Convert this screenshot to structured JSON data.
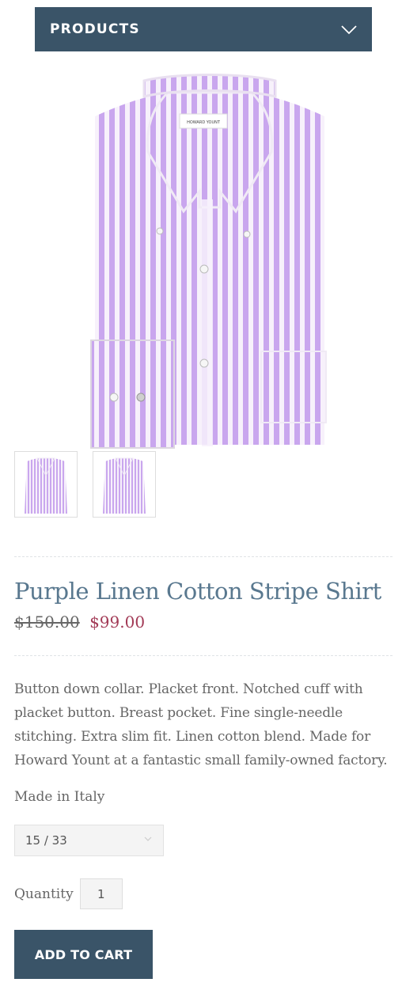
{
  "nav": {
    "title": "PRODUCTS",
    "icon": "chevron-down-icon"
  },
  "product": {
    "title": "Purple Linen Cotton Stripe Shirt",
    "price_original": "$150.00",
    "price_sale": "$99.00",
    "description": "Button down collar. Placket front. Notched cuff with placket button. Breast pocket. Fine single-needle stitching. Extra slim fit. Linen cotton blend. Made for Howard Yount at a fantastic small family-owned factory.",
    "origin": "Made in Italy",
    "label_text": "HOWARD YOUNT"
  },
  "variant_select": {
    "value": "15 / 33"
  },
  "quantity": {
    "label": "Quantity",
    "value": "1"
  },
  "add_to_cart_label": "ADD TO CART",
  "colors": {
    "accent": "#3a5468",
    "title": "#59788f",
    "sale": "#a23a56",
    "stripe": "#c9a6ee"
  }
}
